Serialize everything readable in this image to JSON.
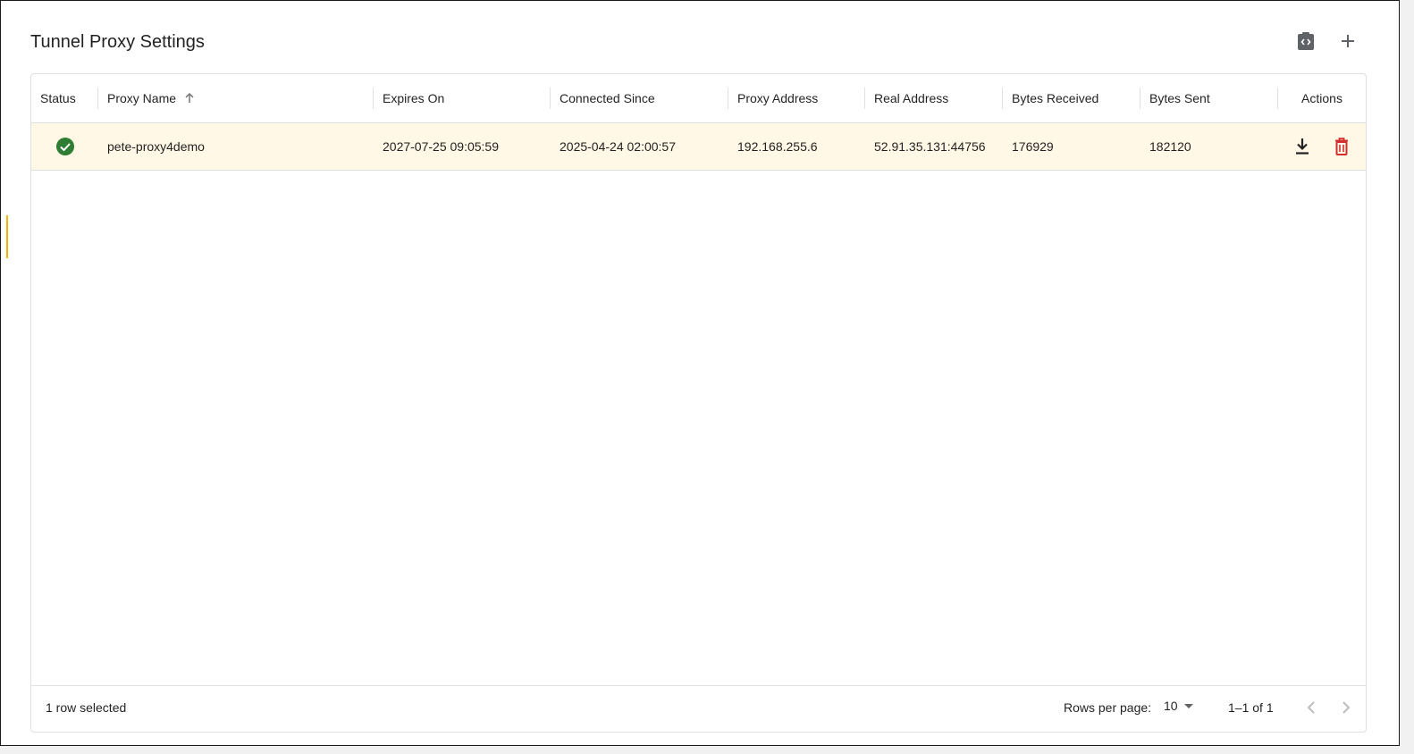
{
  "page": {
    "title": "Tunnel Proxy Settings"
  },
  "toolbar": {
    "code_icon": "code-clipboard-icon",
    "add_icon": "plus-icon"
  },
  "table": {
    "columns": [
      {
        "key": "status",
        "label": "Status"
      },
      {
        "key": "proxy_name",
        "label": "Proxy Name",
        "sorted": "ascending"
      },
      {
        "key": "expires_on",
        "label": "Expires On"
      },
      {
        "key": "connected_since",
        "label": "Connected Since"
      },
      {
        "key": "proxy_address",
        "label": "Proxy Address"
      },
      {
        "key": "real_address",
        "label": "Real Address"
      },
      {
        "key": "bytes_received",
        "label": "Bytes Received"
      },
      {
        "key": "bytes_sent",
        "label": "Bytes Sent"
      },
      {
        "key": "actions",
        "label": "Actions"
      }
    ],
    "rows": [
      {
        "status": "connected",
        "status_icon": "check-circle-icon",
        "proxy_name": "pete-proxy4demo",
        "expires_on": "2027-07-25 09:05:59",
        "connected_since": "2025-04-24 02:00:57",
        "proxy_address": "192.168.255.6",
        "real_address": "52.91.35.131:44756",
        "bytes_received": "176929",
        "bytes_sent": "182120",
        "selected": true
      }
    ]
  },
  "footer": {
    "selected_text": "1 row selected",
    "rows_per_page_label": "Rows per page:",
    "rows_per_page_value": "10",
    "range_text": "1–1 of 1"
  },
  "colors": {
    "selected_row_bg": "#fff8e7",
    "status_ok": "#2e7d32",
    "delete": "#d32f2f",
    "accent_mark": "#f5b400"
  }
}
